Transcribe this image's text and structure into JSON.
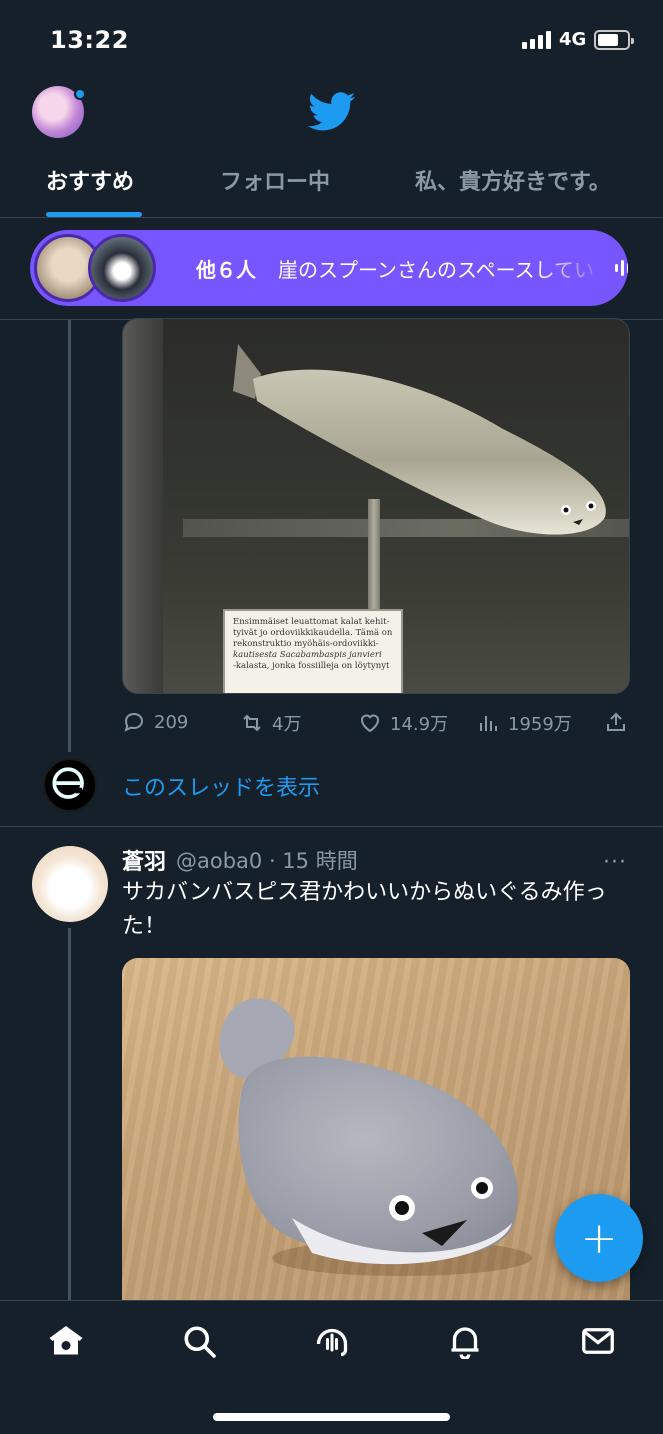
{
  "status": {
    "time": "13:22",
    "network": "4G",
    "battery_percent": 60
  },
  "tabs": [
    {
      "label": "おすすめ",
      "active": true
    },
    {
      "label": "フォロー中",
      "active": false
    },
    {
      "label": "私、貴方好きです。",
      "active": false
    }
  ],
  "space": {
    "count": "他６人",
    "title": "崖のスプーンさんのスペースしてい"
  },
  "tweet1": {
    "sign_lines": [
      "Ensimmäiset leuattomat kalat kehit-",
      "tyivät jo ordoviikkikaudella. Tämä on",
      "rekonstruktio myöhäis-ordoviikki-",
      "kautisesta Sacabambaspis janvieri",
      "-kalasta, jonka fossiilleja on löytynyt"
    ],
    "actions": {
      "replies": "209",
      "retweets": "4万",
      "likes": "14.9万",
      "views": "1959万"
    },
    "thread_link": "このスレッドを表示"
  },
  "tweet2": {
    "name": "蒼羽",
    "handle": "@aoba0 · 15 時間",
    "more": "···",
    "text": "サカバンバスピス君かわいいからぬいぐるみ作った！"
  },
  "fab": {
    "label": "+"
  },
  "colors": {
    "background": "#15202b",
    "accent": "#1d9bf0",
    "space": "#7856ff",
    "muted": "#8b98a5",
    "border": "#38444d"
  },
  "icons": [
    "twitter-bird-icon",
    "home-icon",
    "search-icon",
    "spaces-icon",
    "notifications-icon",
    "messages-icon",
    "reply-icon",
    "retweet-icon",
    "like-icon",
    "views-icon",
    "share-icon",
    "audio-wave-icon"
  ]
}
